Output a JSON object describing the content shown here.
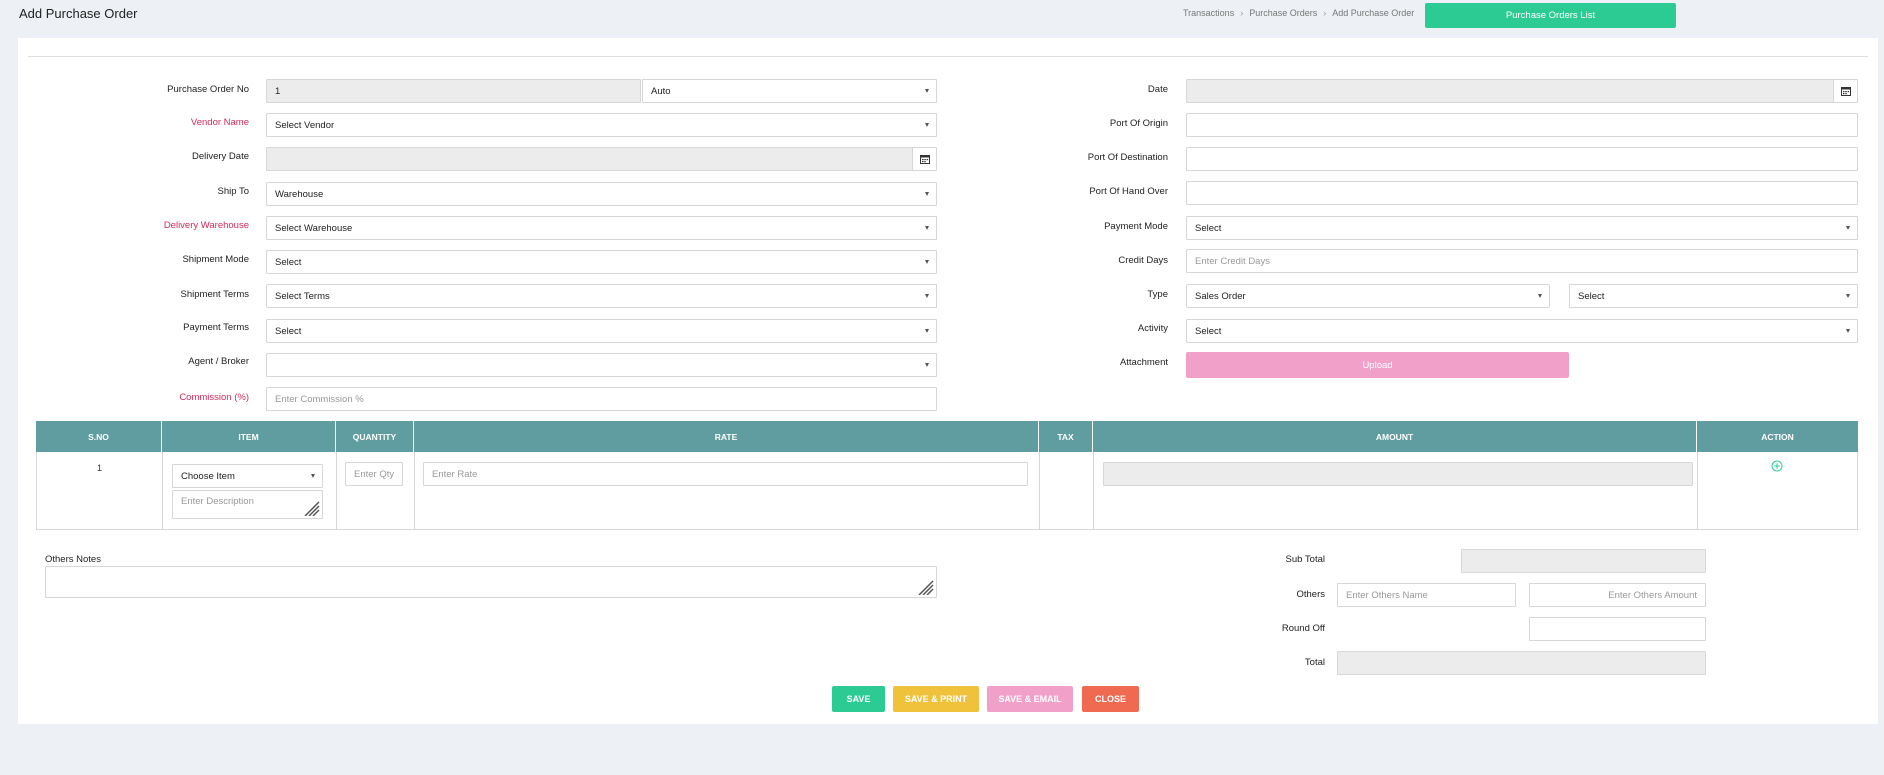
{
  "header": {
    "title": "Add Purchase Order",
    "breadcrumb": [
      "Transactions",
      "Purchase Orders",
      "Add Purchase Order"
    ],
    "list_button": "Purchase Orders List"
  },
  "left_form": {
    "po_no": {
      "label": "Purchase Order No",
      "value": "1",
      "mode": "Auto"
    },
    "vendor": {
      "label": "Vendor Name",
      "value": "Select Vendor"
    },
    "delivery_date": {
      "label": "Delivery Date"
    },
    "ship_to": {
      "label": "Ship To",
      "value": "Warehouse"
    },
    "delivery_warehouse": {
      "label": "Delivery Warehouse",
      "value": "Select Warehouse"
    },
    "shipment_mode": {
      "label": "Shipment Mode",
      "value": "Select"
    },
    "shipment_terms": {
      "label": "Shipment Terms",
      "value": "Select Terms"
    },
    "payment_terms": {
      "label": "Payment Terms",
      "value": "Select"
    },
    "agent": {
      "label": "Agent / Broker",
      "value": ""
    },
    "commission": {
      "label": "Commission (%)",
      "placeholder": "Enter Commission %"
    }
  },
  "right_form": {
    "date": {
      "label": "Date"
    },
    "port_origin": {
      "label": "Port Of Origin"
    },
    "port_destination": {
      "label": "Port Of Destination"
    },
    "port_handover": {
      "label": "Port Of Hand Over"
    },
    "payment_mode": {
      "label": "Payment Mode",
      "value": "Select"
    },
    "credit_days": {
      "label": "Credit Days",
      "placeholder": "Enter Credit Days"
    },
    "type": {
      "label": "Type",
      "value": "Sales Order",
      "value2": "Select"
    },
    "activity": {
      "label": "Activity",
      "value": "Select"
    },
    "attachment": {
      "label": "Attachment",
      "button": "Upload"
    }
  },
  "table": {
    "headers": [
      "S.NO",
      "ITEM",
      "QUANTITY",
      "RATE",
      "TAX",
      "AMOUNT",
      "ACTION"
    ],
    "row": {
      "sno": "1",
      "item": "Choose Item",
      "description_placeholder": "Enter Description",
      "qty_placeholder": "Enter Qty",
      "rate_placeholder": "Enter Rate"
    }
  },
  "notes": {
    "label": "Others Notes"
  },
  "totals": {
    "sub_total": "Sub Total",
    "others": "Others",
    "others_name_placeholder": "Enter Others Name",
    "others_amount_placeholder": "Enter Others Amount",
    "round_off": "Round Off",
    "total": "Total"
  },
  "actions": {
    "save": "SAVE",
    "save_print": "SAVE & PRINT",
    "save_email": "SAVE & EMAIL",
    "close": "CLOSE"
  },
  "colors": {
    "green": "#2ccb93",
    "teal_header": "#5f9da0",
    "pink": "#f1a1c9",
    "yellow": "#f0c23c",
    "red": "#ef6a50",
    "required": "#d12c5a"
  }
}
